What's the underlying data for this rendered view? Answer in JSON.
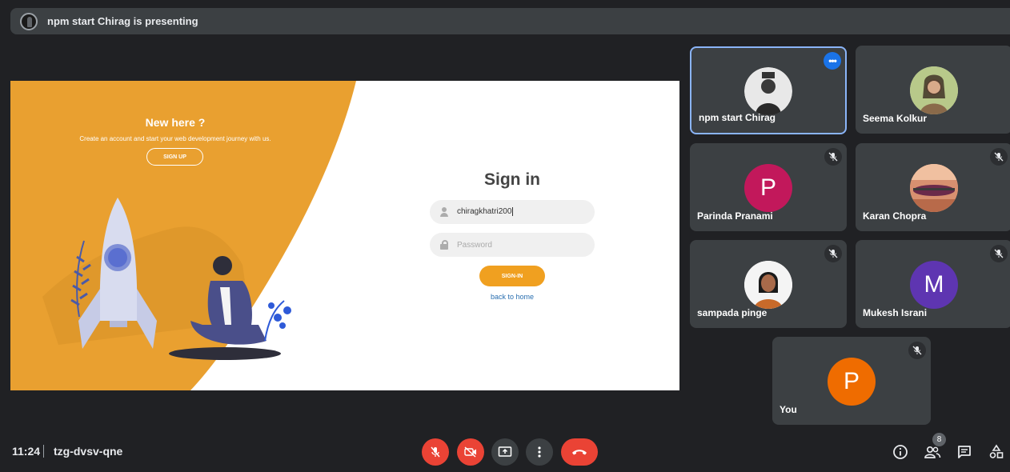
{
  "presenting_bar": {
    "text": "npm start Chirag is presenting"
  },
  "shared_screen": {
    "left_panel": {
      "title": "New here ?",
      "subtitle": "Create an account and start your web development journey with us.",
      "signup_label": "SIGN UP"
    },
    "form": {
      "title": "Sign in",
      "username_value": "chiragkhatri200",
      "password_placeholder": "Password",
      "signin_label": "SIGN-IN",
      "back_link": "back to home"
    },
    "colors": {
      "accent": "#f0a020",
      "panel": "#e9a030"
    }
  },
  "participants": [
    {
      "name": "npm start Chirag",
      "avatar": "photo",
      "active": true,
      "muted": false
    },
    {
      "name": "Seema Kolkur",
      "avatar": "photo",
      "muted": false
    },
    {
      "name": "Parinda Pranami",
      "initial": "P",
      "color": "#c2185b",
      "muted": true
    },
    {
      "name": "Karan Chopra",
      "avatar": "photo",
      "muted": true
    },
    {
      "name": "sampada pinge",
      "avatar": "photo",
      "muted": true
    },
    {
      "name": "Mukesh Israni",
      "initial": "M",
      "color": "#5e35b1",
      "muted": true
    },
    {
      "name": "You",
      "initial": "P",
      "color": "#ef6c00",
      "muted": true
    }
  ],
  "bottom_bar": {
    "time": "11:24",
    "meeting_code": "tzg-dvsv-qne",
    "people_count": "8"
  }
}
